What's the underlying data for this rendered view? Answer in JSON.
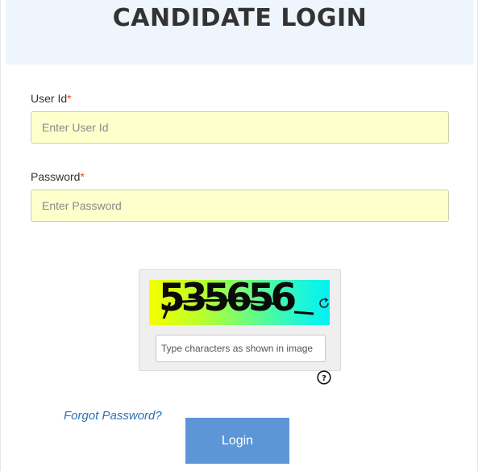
{
  "header": {
    "title": "CANDIDATE LOGIN"
  },
  "form": {
    "user_id": {
      "label": "User Id",
      "required_mark": "*",
      "placeholder": "Enter User Id",
      "value": ""
    },
    "password": {
      "label": "Password",
      "required_mark": "*",
      "placeholder": "Enter Password",
      "value": ""
    }
  },
  "captcha": {
    "code_text": "535656",
    "refresh_icon": "refresh-icon",
    "input_placeholder": "Type characters as shown in image",
    "help_icon": "question-circle-icon"
  },
  "links": {
    "forgot_password": "Forgot Password?"
  },
  "buttons": {
    "login": "Login"
  },
  "colors": {
    "header_bg": "#eef5fc",
    "field_bg": "#ffffcc",
    "required": "#e0521c",
    "link": "#2a72b5",
    "button_bg": "#5d96d6",
    "button_text": "#ffffff"
  }
}
